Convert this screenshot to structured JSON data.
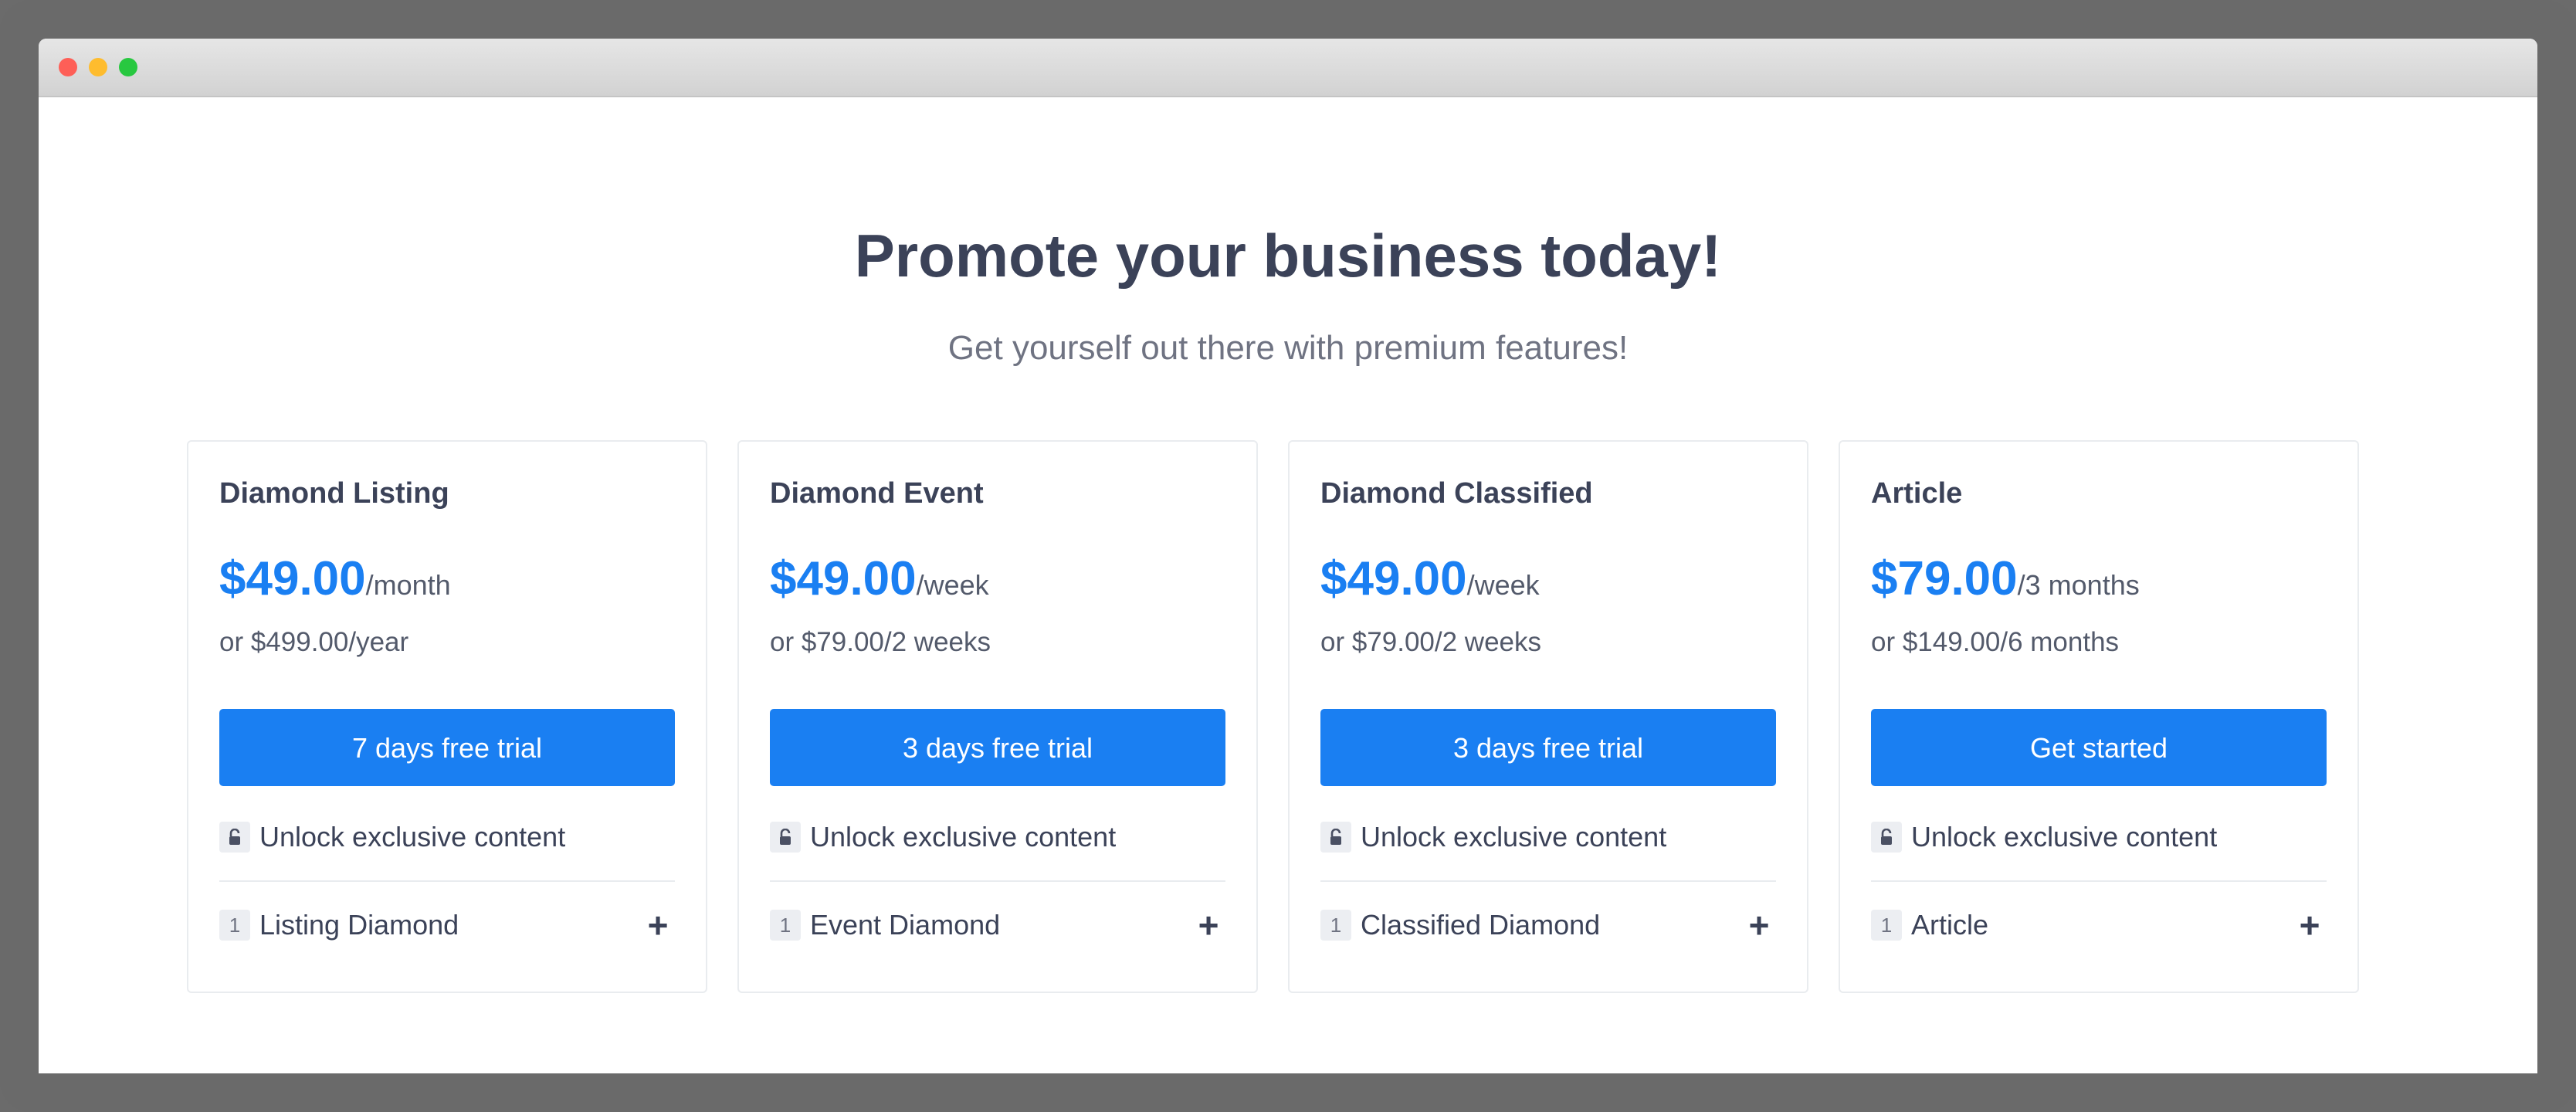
{
  "header": {
    "title": "Promote your business today!",
    "subtitle": "Get yourself out there with premium features!"
  },
  "plans": [
    {
      "name": "Diamond Listing",
      "price": "$49.00",
      "period": "/month",
      "alt_price": "or $499.00/year",
      "cta": "7 days free trial",
      "feature": "Unlock exclusive content",
      "item_qty": "1",
      "item_label": "Listing Diamond",
      "expand": "+"
    },
    {
      "name": "Diamond Event",
      "price": "$49.00",
      "period": "/week",
      "alt_price": "or $79.00/2 weeks",
      "cta": "3 days free trial",
      "feature": "Unlock exclusive content",
      "item_qty": "1",
      "item_label": "Event Diamond",
      "expand": "+"
    },
    {
      "name": "Diamond Classified",
      "price": "$49.00",
      "period": "/week",
      "alt_price": "or $79.00/2 weeks",
      "cta": "3 days free trial",
      "feature": "Unlock exclusive content",
      "item_qty": "1",
      "item_label": "Classified Diamond",
      "expand": "+"
    },
    {
      "name": "Article",
      "price": "$79.00",
      "period": "/3 months",
      "alt_price": "or $149.00/6 months",
      "cta": "Get started",
      "feature": "Unlock exclusive content",
      "item_qty": "1",
      "item_label": "Article",
      "expand": "+"
    }
  ],
  "icons": {
    "feature": "unlock-icon",
    "expand": "plus-icon"
  },
  "colors": {
    "accent": "#1a7ff2",
    "heading": "#3b4258",
    "muted": "#6f7382"
  }
}
